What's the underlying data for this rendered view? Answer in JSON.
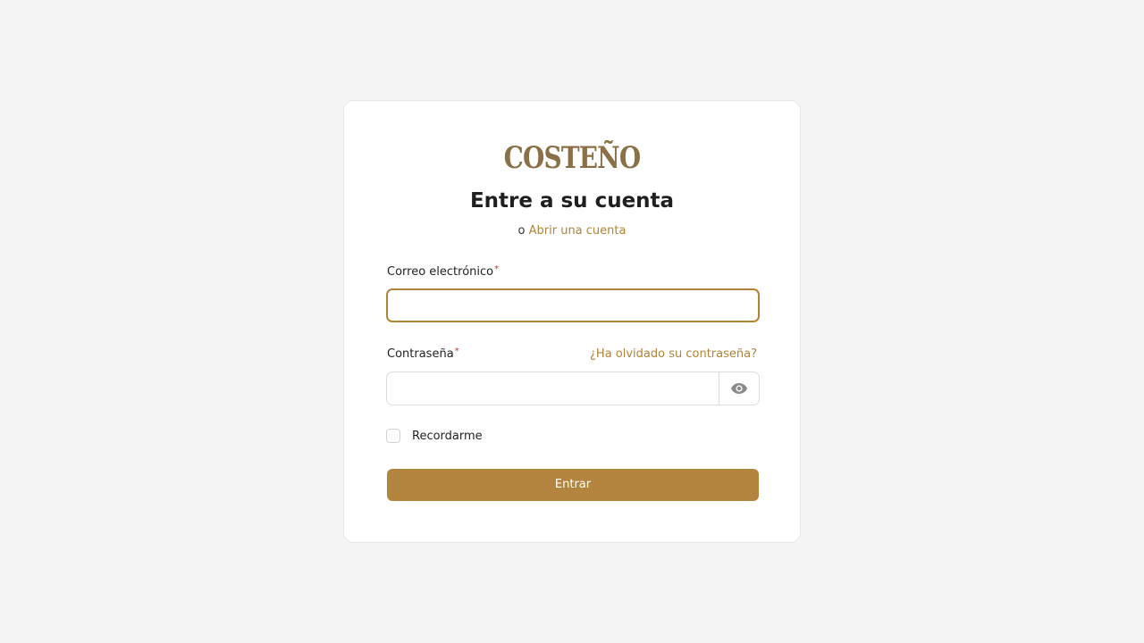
{
  "brand": {
    "logo_text": "COSTEÑO",
    "accent_color": "#b08336"
  },
  "form": {
    "title": "Entre a su cuenta",
    "subtitle_prefix": "o",
    "signup_link": "Abrir una cuenta",
    "email_label": "Correo electrónico",
    "email_value": "",
    "password_label": "Contraseña",
    "password_value": "",
    "required_marker": "*",
    "forgot_link": "¿Ha olvidado su contraseña?",
    "toggle_icon": "eye-icon",
    "remember_label": "Recordarme",
    "remember_checked": false,
    "submit_label": "Entrar"
  }
}
